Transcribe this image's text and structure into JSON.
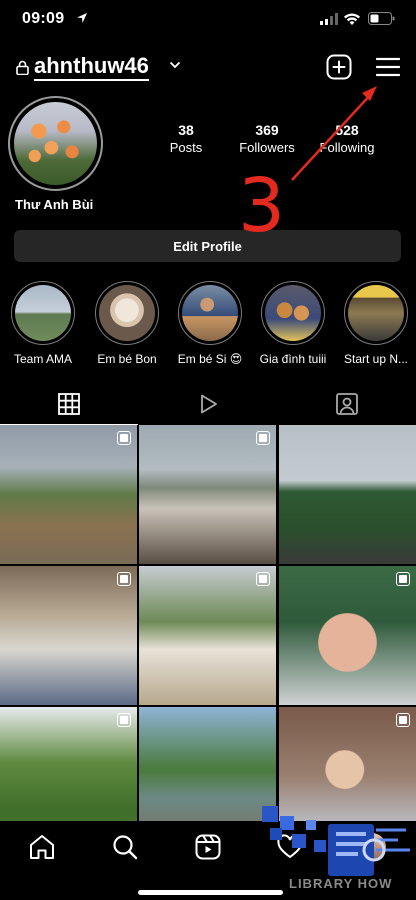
{
  "status": {
    "time": "09:09"
  },
  "header": {
    "username": "ahnthuw46"
  },
  "profile": {
    "display_name": "Thư Anh Bùi",
    "stats": [
      {
        "value": "38",
        "label": "Posts"
      },
      {
        "value": "369",
        "label": "Followers"
      },
      {
        "value": "528",
        "label": "Following"
      }
    ],
    "edit_button": "Edit Profile"
  },
  "annotation": {
    "number": "3",
    "color": "#e42a1e"
  },
  "highlights": [
    {
      "label": "Team AMA"
    },
    {
      "label": "Em bé Bon"
    },
    {
      "label": "Em bé Si 😍"
    },
    {
      "label": "Gia đình tuiii"
    },
    {
      "label": "Start up N..."
    }
  ],
  "tabs": [
    {
      "name": "grid-icon"
    },
    {
      "name": "reels-icon"
    },
    {
      "name": "tagged-icon"
    }
  ],
  "watermark": {
    "text": "LIBRARY HOW"
  },
  "colors": {
    "background": "#000000",
    "button": "#262626",
    "accent": "#e42a1e"
  }
}
